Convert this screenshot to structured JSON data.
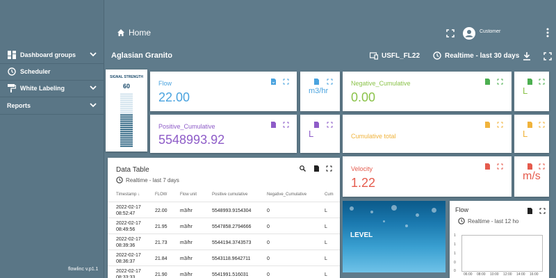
{
  "sidebar": {
    "items": [
      {
        "label": "Dashboard groups",
        "icon": "dashboard-grid-icon",
        "has_chevron": true
      },
      {
        "label": "Scheduler",
        "icon": "clock-icon",
        "has_chevron": false
      },
      {
        "label": "White Labeling",
        "icon": "paint-roller-icon",
        "has_chevron": true
      },
      {
        "label": "Reports",
        "icon": "",
        "has_chevron": true
      }
    ],
    "version": "flowlinc v.p1.1"
  },
  "header": {
    "home_label": "Home",
    "user_label": "Customer",
    "dashboard_title": "Aglasian Granito",
    "device_name": "USFL_FL22",
    "time_window": "Realtime - last 30 days"
  },
  "signal": {
    "label": "SIGNAL STRENGTH",
    "value": "60",
    "level_percent": 60
  },
  "cards": {
    "flow": {
      "title": "Flow",
      "value": "22.00",
      "color": "#4aa3df"
    },
    "flow_unit": {
      "value": "m3/hr",
      "color": "#4aa3df"
    },
    "negative_cumulative": {
      "title": "Negative_Cumulative",
      "value": "0.00",
      "color": "#8bc34a"
    },
    "negative_unit": {
      "value": "L",
      "color": "#8bc34a"
    },
    "positive_cumulative": {
      "title": "Positive_Cumulative",
      "value": "5548993.92",
      "color": "#8e5cc8"
    },
    "positive_unit": {
      "value": "L",
      "color": "#8e5cc8"
    },
    "cumulative_total": {
      "title": "Cumulative total",
      "color": "#f0b33c"
    },
    "cumulative_unit": {
      "value": "L",
      "color": "#f0b33c"
    },
    "velocity": {
      "title": "Velocity",
      "value": "1.22",
      "color": "#e55b4d"
    },
    "velocity_unit": {
      "value": "m/s",
      "color": "#e55b4d"
    }
  },
  "table": {
    "title": "Data Table",
    "subtitle": "Realtime - last 7 days",
    "columns": [
      "Timestamp",
      "FLOW",
      "Flow unit",
      "Positive cumulative",
      "Negative_Cumulative",
      "Cum"
    ],
    "rows": [
      {
        "date": "2022-02-17",
        "time": "08:52:47",
        "flow": "22.00",
        "unit": "m3/hr",
        "pos": "5548993.9154304",
        "neg": "0",
        "cum": "L"
      },
      {
        "date": "2022-02-17",
        "time": "08:49:56",
        "flow": "21.95",
        "unit": "m3/hr",
        "pos": "5547858.2794666",
        "neg": "0",
        "cum": "L"
      },
      {
        "date": "2022-02-17",
        "time": "08:39:36",
        "flow": "21.73",
        "unit": "m3/hr",
        "pos": "5544194.3743573",
        "neg": "0",
        "cum": "L"
      },
      {
        "date": "2022-02-17",
        "time": "08:36:37",
        "flow": "21.84",
        "unit": "m3/hr",
        "pos": "5543118.9642711",
        "neg": "0",
        "cum": "L"
      },
      {
        "date": "2022-02-17",
        "time": "08:33:33",
        "flow": "21.90",
        "unit": "m3/hr",
        "pos": "5541991.516031",
        "neg": "0",
        "cum": "L"
      }
    ]
  },
  "level": {
    "label": "LEVEL"
  },
  "flow_chart": {
    "title": "Flow",
    "subtitle": "Realtime - last 12 ho",
    "y_ticks": [
      "1",
      "1",
      "1",
      "0",
      "0"
    ],
    "x_ticks": [
      "06:00",
      "08:00",
      "10:00",
      "12:00",
      "14:00",
      "16:00"
    ]
  }
}
